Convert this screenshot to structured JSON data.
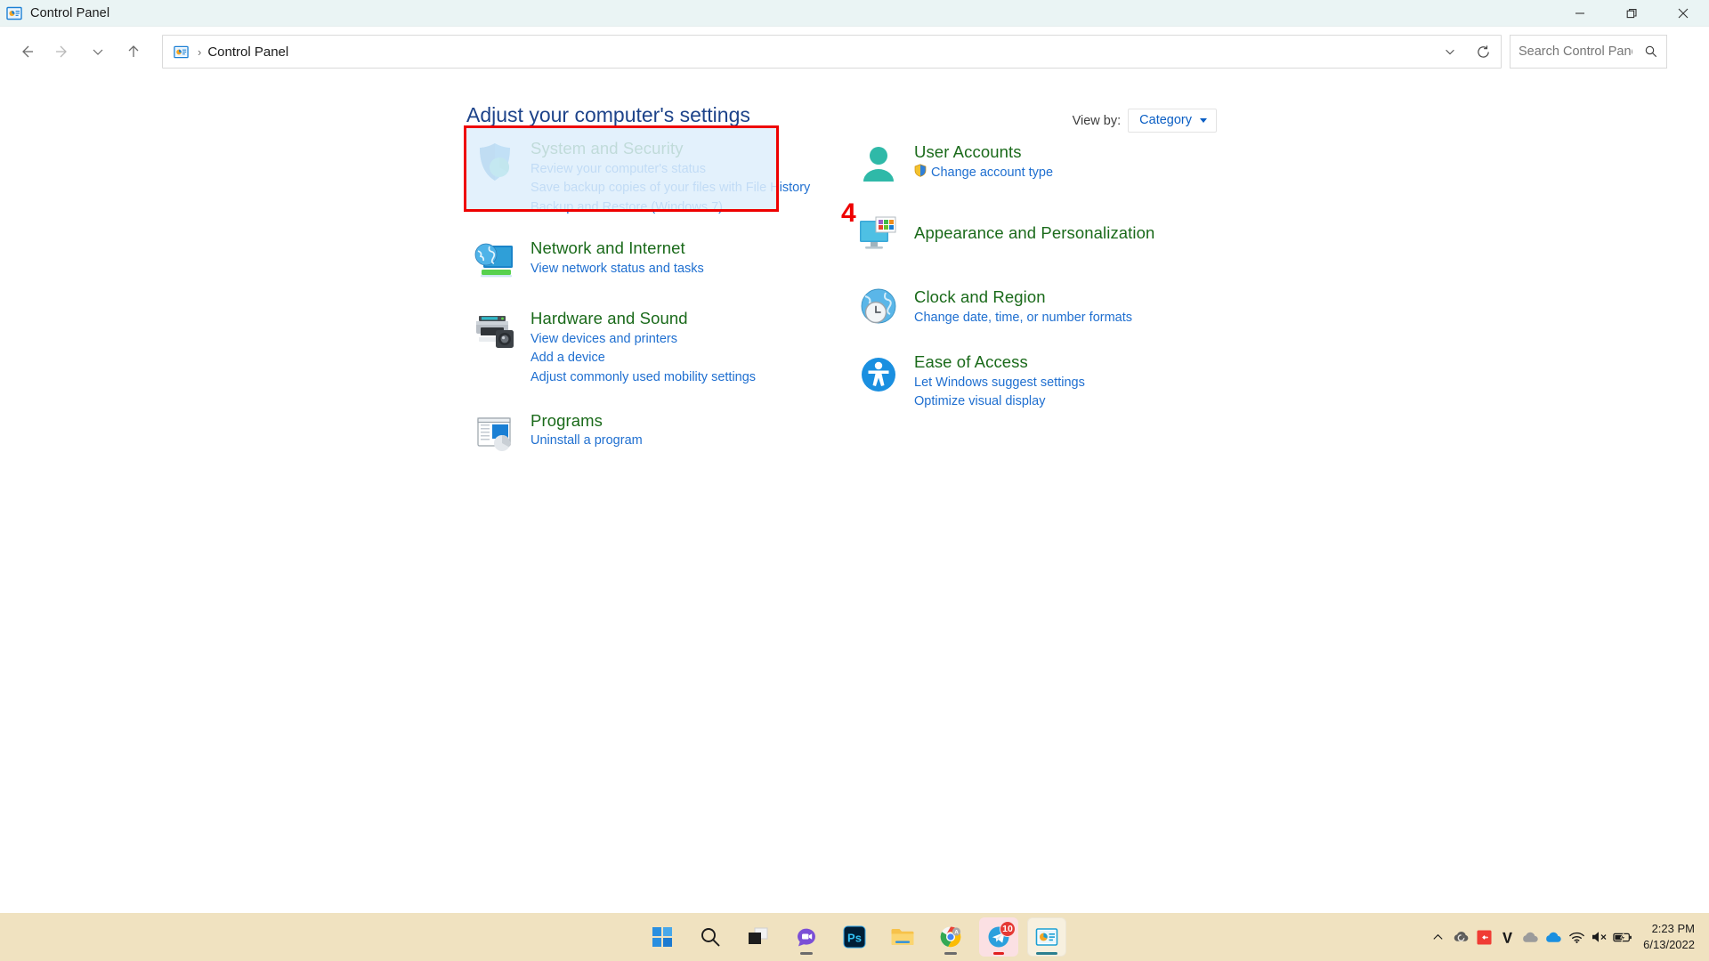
{
  "window": {
    "title": "Control Panel",
    "icon": "control-panel-icon",
    "controls": {
      "minimize": "—",
      "maximize": "❐",
      "close": "✕"
    }
  },
  "navbar": {
    "back": "back-arrow-icon",
    "forward": "forward-arrow-icon",
    "recent": "chevron-down-icon",
    "up": "up-arrow-icon",
    "breadcrumb": {
      "root_icon": "control-panel-icon",
      "separator": "›",
      "path": "Control Panel"
    },
    "dropdown": "chevron-down-icon",
    "refresh": "refresh-icon",
    "search": {
      "placeholder": "Search Control Panel",
      "value": "",
      "icon": "search-icon"
    }
  },
  "page": {
    "heading": "Adjust your computer's settings",
    "view_by_label": "View by:",
    "view_by_value": "Category",
    "annotation": "4"
  },
  "categories": {
    "left": [
      {
        "icon": "shield-icon",
        "title": "System and Security",
        "links": [
          "Review your computer's status",
          "Save backup copies of your files with File History",
          "Backup and Restore (Windows 7)"
        ],
        "highlighted": true
      },
      {
        "icon": "network-monitor-globe-icon",
        "title": "Network and Internet",
        "links": [
          "View network status and tasks"
        ],
        "highlighted": false
      },
      {
        "icon": "printer-icon",
        "title": "Hardware and Sound",
        "links": [
          "View devices and printers",
          "Add a device",
          "Adjust commonly used mobility settings"
        ],
        "highlighted": false
      },
      {
        "icon": "programs-window-icon",
        "title": "Programs",
        "links": [
          "Uninstall a program"
        ],
        "highlighted": false
      }
    ],
    "right": [
      {
        "icon": "user-account-icon",
        "title": "User Accounts",
        "links": [
          "Change account type"
        ],
        "link_icons": [
          "uac-shield-icon"
        ],
        "highlighted": false
      },
      {
        "icon": "appearance-monitor-icon",
        "title": "Appearance and Personalization",
        "links": [],
        "highlighted": false
      },
      {
        "icon": "clock-globe-icon",
        "title": "Clock and Region",
        "links": [
          "Change date, time, or number formats"
        ],
        "highlighted": false
      },
      {
        "icon": "ease-of-access-icon",
        "title": "Ease of Access",
        "links": [
          "Let Windows suggest settings",
          "Optimize visual display"
        ],
        "highlighted": false
      }
    ]
  },
  "taskbar": {
    "items": [
      {
        "name": "start-button",
        "label": "Start"
      },
      {
        "name": "search-taskbar-button",
        "label": "Search"
      },
      {
        "name": "task-view-button",
        "label": "Task View"
      },
      {
        "name": "chat-button",
        "label": "Chat"
      },
      {
        "name": "photoshop-button",
        "label": "Ps"
      },
      {
        "name": "file-explorer-button",
        "label": "File Explorer"
      },
      {
        "name": "chrome-button",
        "label": "Google Chrome"
      },
      {
        "name": "telegram-button",
        "label": "Telegram",
        "badge": "10"
      },
      {
        "name": "control-panel-taskbar-button",
        "label": "Control Panel",
        "active": true
      }
    ],
    "tray": [
      {
        "name": "show-hidden-icons-button",
        "label": "Show hidden icons"
      },
      {
        "name": "creative-cloud-icon",
        "label": "Creative Cloud"
      },
      {
        "name": "red-app-icon",
        "label": "App"
      },
      {
        "name": "v-app-icon",
        "label": "V"
      },
      {
        "name": "cloud-icon",
        "label": "Cloud"
      },
      {
        "name": "onedrive-icon",
        "label": "OneDrive"
      },
      {
        "name": "wifi-icon",
        "label": "Network"
      },
      {
        "name": "volume-muted-icon",
        "label": "Volume muted"
      },
      {
        "name": "battery-charging-icon",
        "label": "Battery charging"
      }
    ],
    "clock": {
      "time": "2:23 PM",
      "date": "6/13/2022"
    }
  },
  "colors": {
    "title_green": "#1a6a1a",
    "link_blue": "#1f6fd0",
    "heading_blue": "#1d438a",
    "annotation_red": "#ee0000",
    "taskbar_bg": "#f0e2c0",
    "titlebar_bg": "#eaf4f4"
  }
}
